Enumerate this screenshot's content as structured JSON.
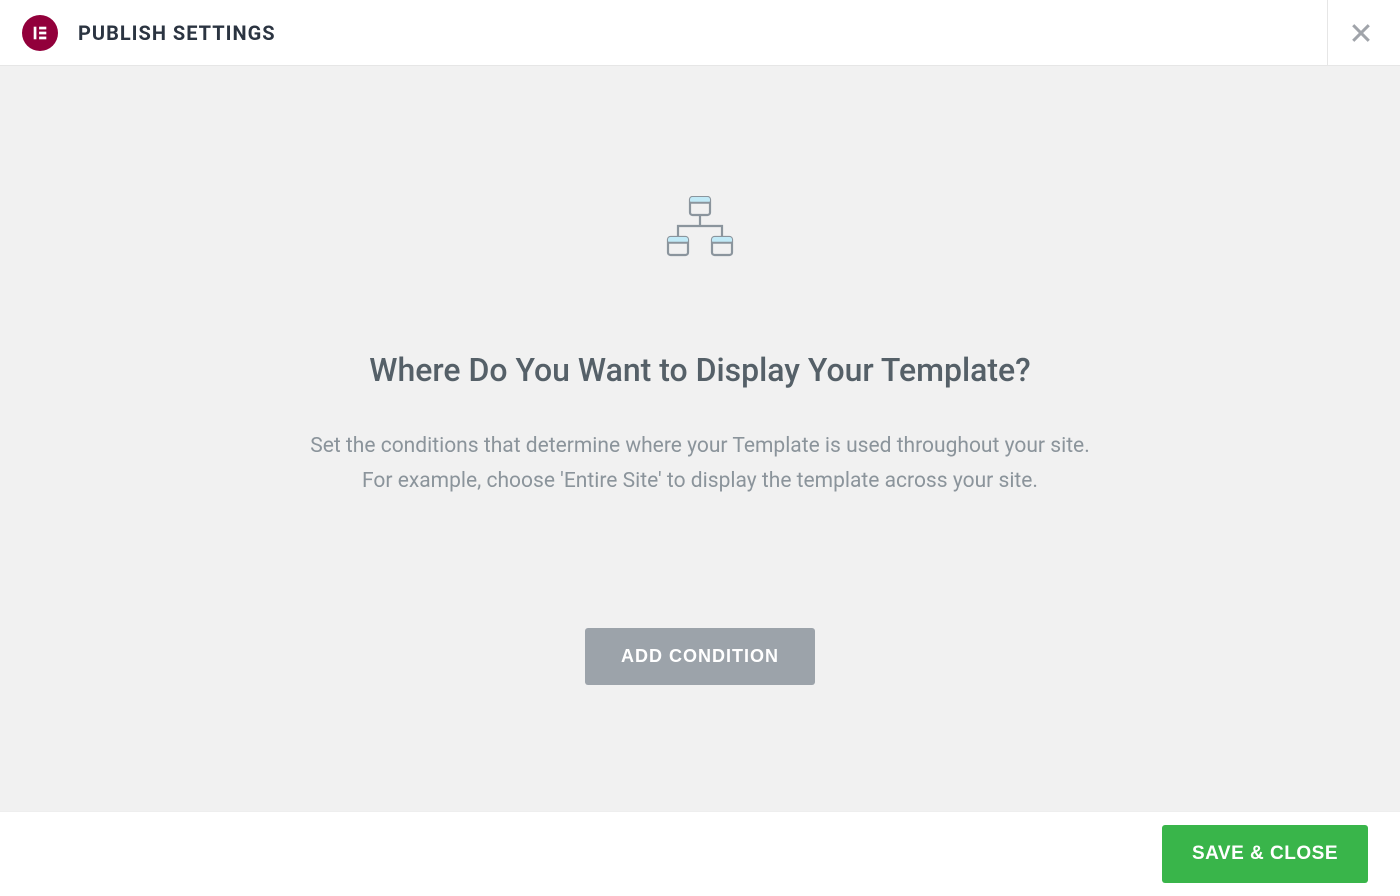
{
  "header": {
    "title": "PUBLISH SETTINGS"
  },
  "main": {
    "heading": "Where Do You Want to Display Your Template?",
    "description_line1": "Set the conditions that determine where your Template is used throughout your site.",
    "description_line2": "For example, choose 'Entire Site' to display the template across your site.",
    "add_condition_label": "ADD CONDITION"
  },
  "footer": {
    "save_close_label": "SAVE & CLOSE"
  },
  "icons": {
    "logo": "elementor-logo-icon",
    "hierarchy": "hierarchy-icon",
    "close": "close-icon"
  },
  "colors": {
    "brand": "#92003B",
    "accent_green": "#39b54a",
    "neutral_button": "#9ca3aa",
    "content_bg": "#f1f1f1",
    "icon_fill": "#c1eaf7",
    "icon_stroke": "#8b959d"
  }
}
